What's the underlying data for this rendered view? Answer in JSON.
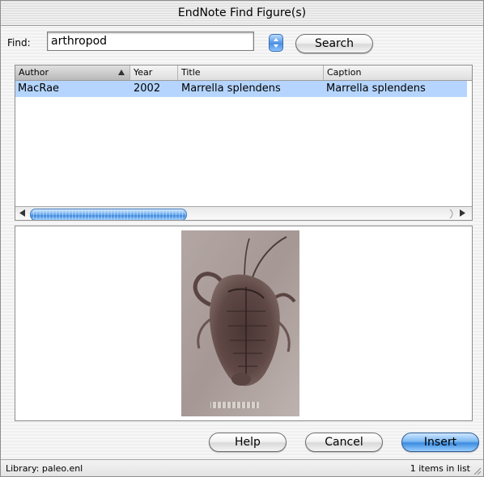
{
  "window": {
    "title": "EndNote Find Figure(s)"
  },
  "find": {
    "label": "Find:",
    "value": "arthropod",
    "search_button": "Search"
  },
  "table": {
    "columns": [
      "Author",
      "Year",
      "Title",
      "Caption"
    ],
    "sorted_column": "Author",
    "sort_direction": "ascending",
    "rows": [
      {
        "author": "MacRae",
        "year": "2002",
        "title": "Marrella splendens",
        "caption": "Marrella splendens"
      }
    ],
    "selected_row": 0
  },
  "preview": {
    "subject": "Marrella splendens fossil image"
  },
  "buttons": {
    "help": "Help",
    "cancel": "Cancel",
    "insert": "Insert"
  },
  "status": {
    "library": "Library: paleo.enl",
    "count": "1 items in list"
  },
  "colors": {
    "selection": "#b5d5ff",
    "accent": "#3b86dd"
  },
  "icons": [
    "stepper-icon",
    "sort-ascending-icon",
    "scroll-left-icon",
    "scroll-right-icon",
    "resize-grip-icon"
  ]
}
